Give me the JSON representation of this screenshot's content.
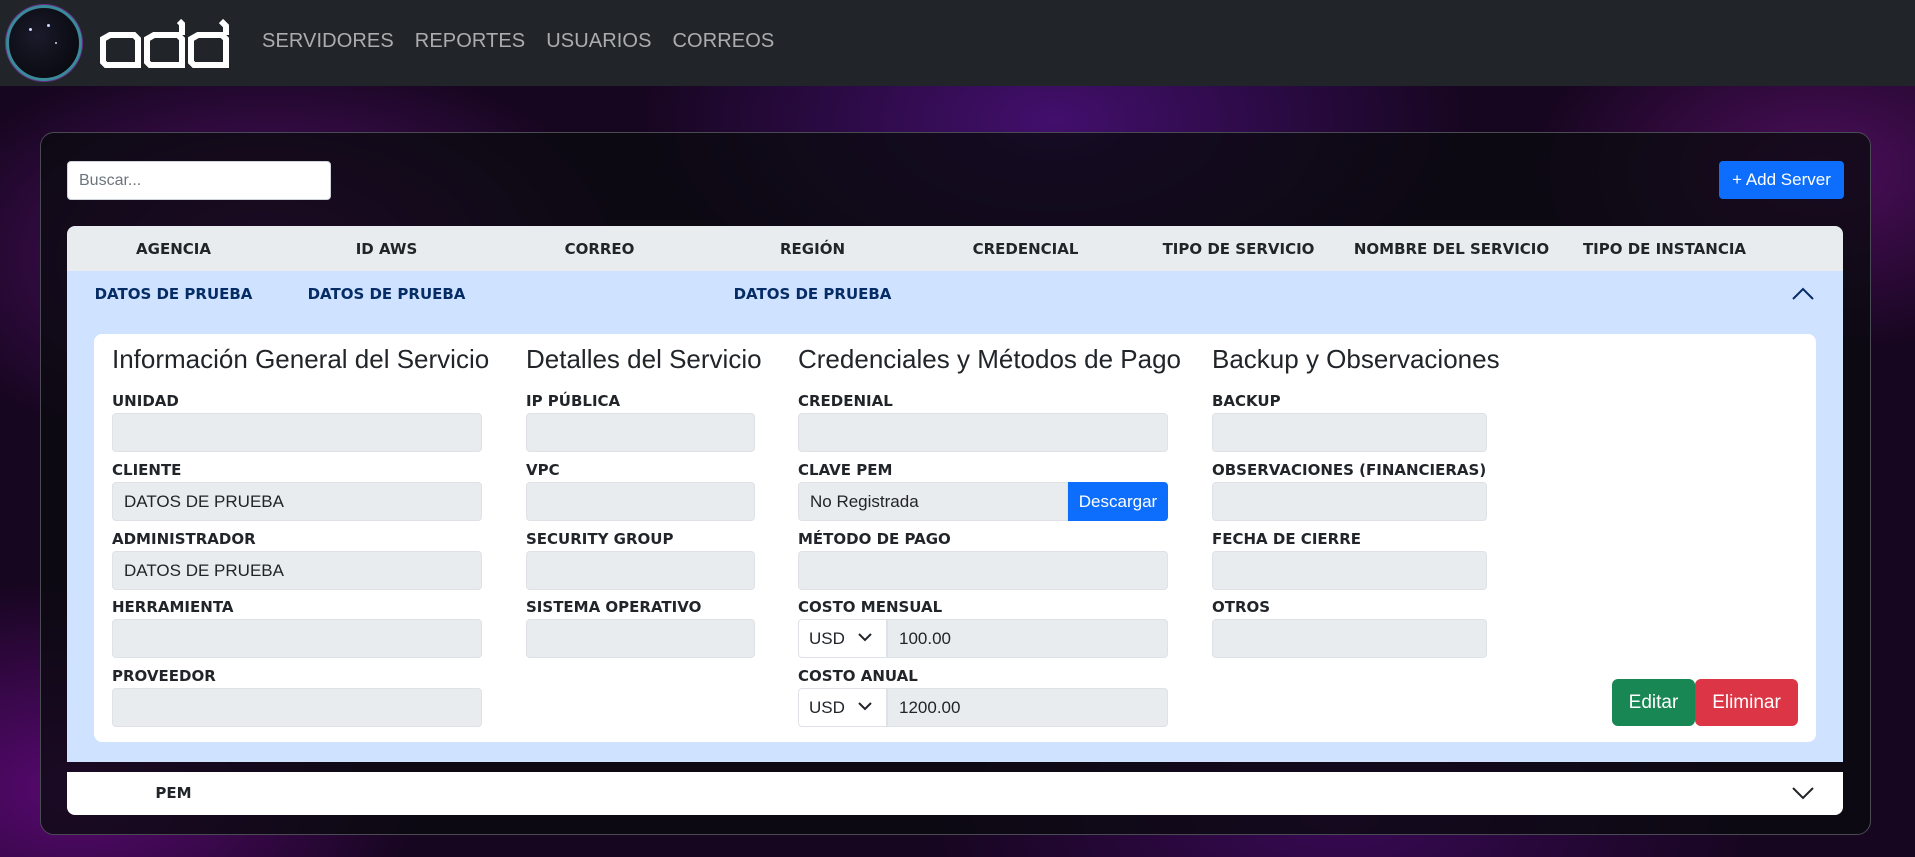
{
  "nav": {
    "links": [
      "SERVIDORES",
      "REPORTES",
      "USUARIOS",
      "CORREOS"
    ]
  },
  "toolbar": {
    "search_placeholder": "Buscar...",
    "add_label": "+ Add Server"
  },
  "table": {
    "headers": [
      "AGENCIA",
      "ID AWS",
      "CORREO",
      "REGIÓN",
      "CREDENCIAL",
      "TIPO DE SERVICIO",
      "NOMBRE DEL SERVICIO",
      "TIPO DE INSTANCIA"
    ],
    "expanded_row": {
      "agencia": "DATOS DE PRUEBA",
      "id_aws": "DATOS DE PRUEBA",
      "correo": "",
      "region": "DATOS DE PRUEBA",
      "credencial": "",
      "tipo_servicio": "",
      "nombre_servicio": "",
      "tipo_instancia": ""
    },
    "collapsed_row": {
      "agencia": "PEM"
    }
  },
  "details": {
    "general": {
      "title": "Información General del Servicio",
      "unidad_label": "UNIDAD",
      "unidad": "",
      "cliente_label": "CLIENTE",
      "cliente": "DATOS DE PRUEBA",
      "administrador_label": "ADMINISTRADOR",
      "administrador": "DATOS DE PRUEBA",
      "herramienta_label": "HERRAMIENTA",
      "herramienta": "",
      "proveedor_label": "PROVEEDOR",
      "proveedor": ""
    },
    "servicio": {
      "title": "Detalles del Servicio",
      "ip_label": "IP PÚBLICA",
      "ip": "",
      "vpc_label": "VPC",
      "vpc": "",
      "sg_label": "SECURITY GROUP",
      "sg": "",
      "so_label": "SISTEMA OPERATIVO",
      "so": ""
    },
    "credenciales": {
      "title": "Credenciales y Métodos de Pago",
      "credencial_label": "CREDENIAL",
      "credencial": "",
      "pem_label": "CLAVE PEM",
      "pem": "No Registrada",
      "download_label": "Descargar",
      "metodo_label": "MÉTODO DE PAGO",
      "metodo": "",
      "mensual_label": "COSTO MENSUAL",
      "mensual_currency": "USD",
      "mensual": "100.00",
      "anual_label": "COSTO ANUAL",
      "anual_currency": "USD",
      "anual": "1200.00"
    },
    "backup": {
      "title": "Backup y Observaciones",
      "backup_label": "BACKUP",
      "backup": "",
      "obs_label": "OBSERVACIONES (FINANCIERAS)",
      "obs": "",
      "cierre_label": "FECHA DE CIERRE",
      "cierre": "",
      "otros_label": "OTROS",
      "otros": ""
    },
    "actions": {
      "edit_label": "Editar",
      "delete_label": "Eliminar"
    }
  },
  "colors": {
    "navbar": "#212529",
    "primary": "#0d6efd",
    "success": "#198754",
    "danger": "#dc3545",
    "row_expanded": "#cfe2ff"
  }
}
